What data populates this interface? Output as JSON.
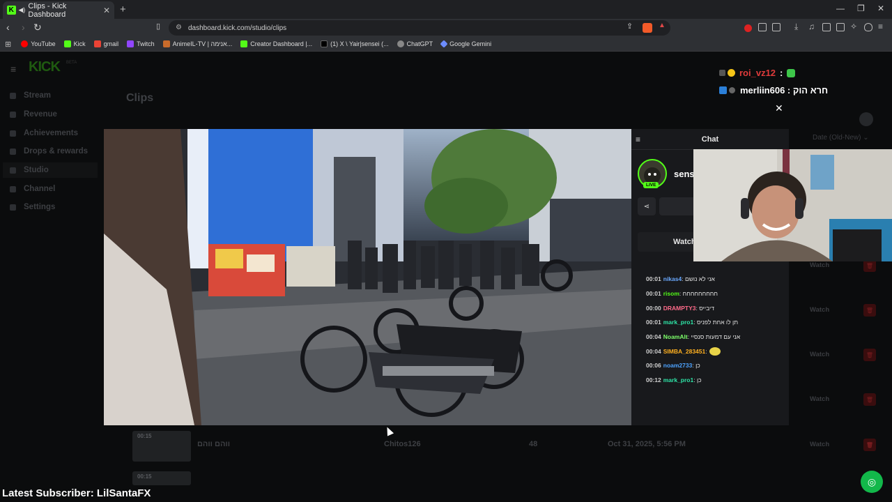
{
  "browser": {
    "tab_title": "Clips - Kick Dashboard",
    "tab_favicon": "K",
    "url": "dashboard.kick.com/studio/clips",
    "bookmarks": [
      "YouTube",
      "Kick",
      "gmail",
      "Twitch",
      "AnimeIL-TV | אנימה...",
      "Creator Dashboard |...",
      "(1) X \\ Yair|sensei (...",
      "ChatGPT",
      "Google Gemini"
    ]
  },
  "sidebar": {
    "logo": "KICK",
    "beta": "BETA",
    "items": [
      {
        "label": "Stream",
        "icon": "stream-icon"
      },
      {
        "label": "Revenue",
        "icon": "revenue-icon"
      },
      {
        "label": "Achievements",
        "icon": "trophy-icon"
      },
      {
        "label": "Drops & rewards",
        "icon": "gift-icon"
      },
      {
        "label": "Studio",
        "icon": "studio-icon",
        "active": true
      },
      {
        "label": "Channel",
        "icon": "channel-icon"
      },
      {
        "label": "Settings",
        "icon": "gear-icon"
      }
    ]
  },
  "main": {
    "title": "Clips",
    "sort_label": "Date (Old-New)",
    "watch_label": "Watch",
    "clip": {
      "duration": "00:15",
      "title": "ווהם ווהם",
      "creator": "Chitos126",
      "views": "48",
      "date": "Oct 31, 2025, 5:56 PM"
    },
    "clip2_duration": "00:15"
  },
  "modal": {
    "chat_title": "Chat",
    "channel_name": "sens",
    "live_label": "LIVE",
    "watch_label": "Watch",
    "messages": [
      {
        "time": "00:01",
        "user": "nikas4",
        "color": "#6aa9ff",
        "text": "אני לא נושם"
      },
      {
        "time": "00:01",
        "user": "risom",
        "color": "#53fc18",
        "text": "חחחחחחחחח"
      },
      {
        "time": "00:00",
        "user": "DRAMPTY3",
        "color": "#ff6b8a",
        "text": "דיבייס"
      },
      {
        "time": "00:01",
        "user": "mark_pro1",
        "color": "#2ee6a8",
        "text": "תן לו אחת לפניס"
      },
      {
        "time": "00:04",
        "user": "NoamAlt",
        "color": "#7dff6a",
        "text": "אני עם דמעות סנסיי"
      },
      {
        "time": "00:04",
        "user": "SIMBA_283451",
        "color": "#ffb020",
        "text": ""
      },
      {
        "time": "00:06",
        "user": "noam2733",
        "color": "#4da3ff",
        "text": "כן"
      },
      {
        "time": "00:12",
        "user": "mark_pro1",
        "color": "#2ee6a8",
        "text": "כן"
      }
    ]
  },
  "overlay": {
    "line1_user": "roi_vz12",
    "line1_sep": ":",
    "line2_text": "merliin606 : חרא הוק",
    "latest_subscriber": "Latest Subscriber: LilSantaFX"
  }
}
